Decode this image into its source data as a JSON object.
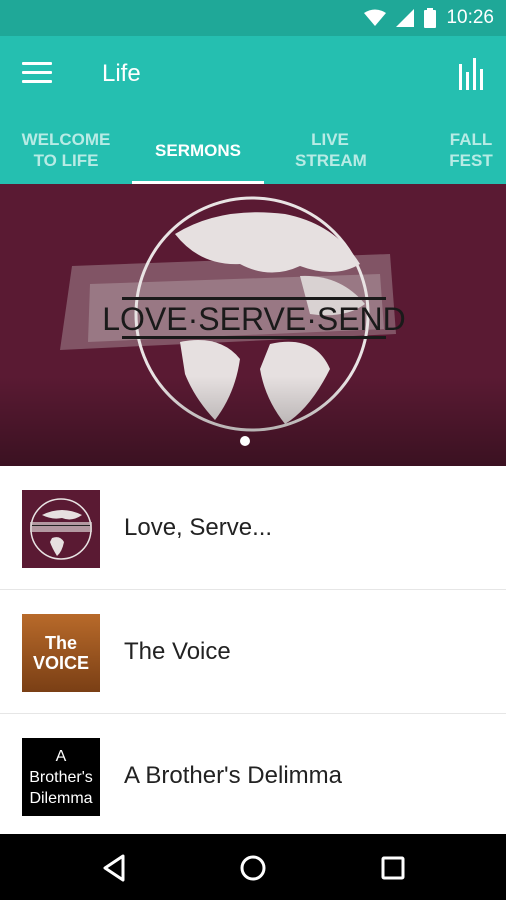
{
  "status": {
    "time": "10:26"
  },
  "appbar": {
    "title": "Life"
  },
  "tabs": [
    {
      "label": "WELCOME TO LIFE",
      "active": false
    },
    {
      "label": "SERMONS",
      "active": true
    },
    {
      "label": "LIVE STREAM",
      "active": false
    },
    {
      "label": "FALL FEST",
      "active": false
    }
  ],
  "hero": {
    "banner_text": "LOVE·SERVE·SEND"
  },
  "sermons": [
    {
      "title": "Love, Serve..."
    },
    {
      "title": "The Voice",
      "thumb_text": "The VOICE"
    },
    {
      "title": "A Brother's Delimma",
      "thumb_text": "A Brother's Dilemma"
    }
  ],
  "colors": {
    "accent": "#25bfb0",
    "status": "#1fa898",
    "hero_bg": "#5a1a33"
  }
}
